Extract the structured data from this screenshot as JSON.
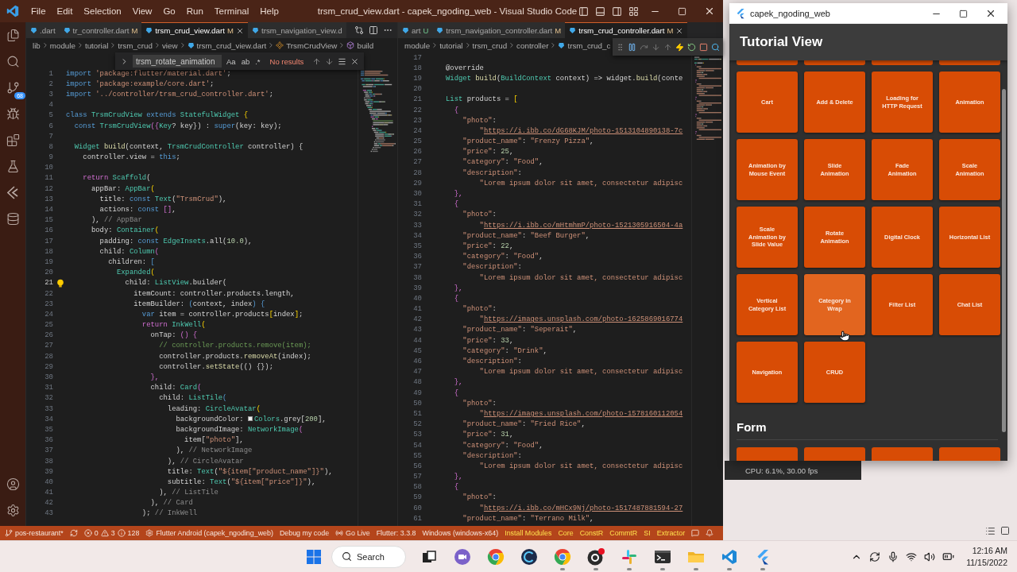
{
  "window": {
    "title": "trsm_crud_view.dart - capek_ngoding_web - Visual Studio Code",
    "menu": [
      "File",
      "Edit",
      "Selection",
      "View",
      "Go",
      "Run",
      "Terminal",
      "Help"
    ]
  },
  "activity_bar": {
    "items": [
      {
        "kind": "files"
      },
      {
        "kind": "search"
      },
      {
        "kind": "source_control",
        "badge": "68"
      },
      {
        "kind": "run"
      },
      {
        "kind": "extensions"
      },
      {
        "kind": "testing"
      },
      {
        "kind": "flutter"
      },
      {
        "kind": "database"
      }
    ],
    "bottom": [
      {
        "kind": "account"
      },
      {
        "kind": "settings"
      }
    ]
  },
  "editors": [
    {
      "tabs": [
        {
          "label": ".dart",
          "selected": false
        },
        {
          "label": "tr_controller.dart",
          "status": "M",
          "selected": false
        },
        {
          "label": "trsm_crud_view.dart",
          "status": "M",
          "selected": true
        },
        {
          "label": "trsm_navigation_view.d",
          "selected": false
        }
      ],
      "breadcrumbs": [
        {
          "label": "lib",
          "kind": "folder"
        },
        {
          "label": "module",
          "kind": "folder"
        },
        {
          "label": "tutorial",
          "kind": "folder"
        },
        {
          "label": "trsm_crud",
          "kind": "folder"
        },
        {
          "label": "view",
          "kind": "folder"
        },
        {
          "label": "trsm_crud_view.dart",
          "kind": "file"
        },
        {
          "label": "TrsmCrudView",
          "kind": "class"
        },
        {
          "label": "build",
          "kind": "method"
        }
      ],
      "find": {
        "value": "trsm_rotate_animation",
        "options": [
          "Aa",
          "ab",
          ".*"
        ],
        "result": "No results"
      },
      "lines": [
        {
          "n": "1",
          "active": false,
          "tokens": [
            {
              "text": "import ",
              "kind": "keyword"
            },
            {
              "text": "'package:flutter/material.dart'",
              "kind": "string"
            },
            {
              "text": ";",
              "kind": "plain"
            }
          ]
        },
        {
          "n": "2",
          "active": false,
          "tokens": [
            {
              "text": "import ",
              "kind": "keyword"
            },
            {
              "text": "'package:example/core.dart'",
              "kind": "string"
            },
            {
              "text": ";",
              "kind": "plain"
            }
          ]
        },
        {
          "n": "3",
          "active": false,
          "tokens": [
            {
              "text": "import ",
              "kind": "keyword"
            },
            {
              "text": "'../controller/trsm_crud_controller.dart'",
              "kind": "string"
            },
            {
              "text": ";",
              "kind": "plain"
            }
          ]
        },
        {
          "n": "4",
          "active": false
        },
        {
          "n": "5",
          "active": false,
          "tokens": [
            {
              "text": "class ",
              "kind": "keyword"
            },
            {
              "text": "TrsmCrudView ",
              "kind": "type"
            },
            {
              "text": "extends ",
              "kind": "keyword"
            },
            {
              "text": "StatefulWidget ",
              "kind": "type"
            },
            {
              "text": "{",
              "kind": "bracket"
            }
          ]
        },
        {
          "n": "6",
          "active": false,
          "tokens": [
            {
              "text": "  const ",
              "kind": "keyword"
            },
            {
              "text": "TrsmCrudView",
              "kind": "type"
            },
            {
              "text": "({",
              "kind": "control"
            },
            {
              "text": "Key",
              "kind": "type"
            },
            {
              "text": "? key}) : ",
              "kind": "plain"
            },
            {
              "text": "super",
              "kind": "keyword"
            },
            {
              "text": "(key: key);",
              "kind": "plain"
            }
          ]
        },
        {
          "n": "7",
          "active": false
        },
        {
          "n": "8",
          "active": false,
          "tokens": [
            {
              "text": "  Widget ",
              "kind": "type"
            },
            {
              "text": "build",
              "kind": "function"
            },
            {
              "text": "(context, ",
              "kind": "plain"
            },
            {
              "text": "TrsmCrudController ",
              "kind": "type"
            },
            {
              "text": "controller) {",
              "kind": "plain"
            }
          ]
        },
        {
          "n": "9",
          "active": false,
          "tokens": [
            {
              "text": "    controller.view = ",
              "kind": "plain"
            },
            {
              "text": "this",
              "kind": "keyword"
            },
            {
              "text": ";",
              "kind": "plain"
            }
          ]
        },
        {
          "n": "10",
          "active": false
        },
        {
          "n": "11",
          "active": false,
          "tokens": [
            {
              "text": "    return ",
              "kind": "control"
            },
            {
              "text": "Scaffold",
              "kind": "type"
            },
            {
              "text": "(",
              "kind": "plain"
            }
          ]
        },
        {
          "n": "12",
          "active": false,
          "tokens": [
            {
              "text": "      appBar: ",
              "kind": "plain"
            },
            {
              "text": "AppBar",
              "kind": "type"
            },
            {
              "text": "(",
              "kind": "bracket"
            }
          ]
        },
        {
          "n": "13",
          "active": false,
          "tokens": [
            {
              "text": "        title: ",
              "kind": "plain"
            },
            {
              "text": "const ",
              "kind": "keyword"
            },
            {
              "text": "Text",
              "kind": "type"
            },
            {
              "text": "(",
              "kind": "plain"
            },
            {
              "text": "\"TrsmCrud\"",
              "kind": "string"
            },
            {
              "text": "),",
              "kind": "plain"
            }
          ]
        },
        {
          "n": "14",
          "active": false,
          "tokens": [
            {
              "text": "        actions: ",
              "kind": "plain"
            },
            {
              "text": "const ",
              "kind": "keyword"
            },
            {
              "text": "[]",
              "kind": "control"
            },
            {
              "text": ",",
              "kind": "plain"
            }
          ]
        },
        {
          "n": "15",
          "active": false,
          "tokens": [
            {
              "text": "      ), ",
              "kind": "plain"
            },
            {
              "text": "// AppBar",
              "kind": "label"
            }
          ]
        },
        {
          "n": "16",
          "active": false,
          "tokens": [
            {
              "text": "      body: ",
              "kind": "plain"
            },
            {
              "text": "Container",
              "kind": "type"
            },
            {
              "text": "(",
              "kind": "bracket"
            }
          ]
        },
        {
          "n": "17",
          "active": false,
          "tokens": [
            {
              "text": "        padding: ",
              "kind": "plain"
            },
            {
              "text": "const ",
              "kind": "keyword"
            },
            {
              "text": "EdgeInsets",
              "kind": "type"
            },
            {
              "text": ".all(",
              "kind": "plain"
            },
            {
              "text": "10.0",
              "kind": "number"
            },
            {
              "text": "),",
              "kind": "plain"
            }
          ]
        },
        {
          "n": "18",
          "active": false,
          "tokens": [
            {
              "text": "        child: ",
              "kind": "plain"
            },
            {
              "text": "Column",
              "kind": "type"
            },
            {
              "text": "(",
              "kind": "control"
            }
          ]
        },
        {
          "n": "19",
          "active": false,
          "tokens": [
            {
              "text": "          children: ",
              "kind": "plain"
            },
            {
              "text": "[",
              "kind": "keyword"
            }
          ]
        },
        {
          "n": "20",
          "active": false,
          "tokens": [
            {
              "text": "            Expanded",
              "kind": "type"
            },
            {
              "text": "(",
              "kind": "bracket"
            }
          ]
        },
        {
          "n": "21",
          "active": true,
          "tokens": [
            {
              "text": "              child: ",
              "kind": "plain"
            },
            {
              "text": "ListView",
              "kind": "type"
            },
            {
              "text": ".builder(",
              "kind": "plain"
            }
          ]
        },
        {
          "n": "22",
          "active": false,
          "tokens": [
            {
              "text": "                itemCount: controller.products.length,",
              "kind": "plain"
            }
          ]
        },
        {
          "n": "23",
          "active": false,
          "tokens": [
            {
              "text": "                itemBuilder: ",
              "kind": "plain"
            },
            {
              "text": "(",
              "kind": "keyword"
            },
            {
              "text": "context, index",
              "kind": "plain"
            },
            {
              "text": ") {",
              "kind": "keyword"
            }
          ]
        },
        {
          "n": "24",
          "active": false,
          "tokens": [
            {
              "text": "                  var ",
              "kind": "keyword"
            },
            {
              "text": "item = controller.products",
              "kind": "plain"
            },
            {
              "text": "[",
              "kind": "bracket"
            },
            {
              "text": "index",
              "kind": "plain"
            },
            {
              "text": "]",
              "kind": "bracket"
            },
            {
              "text": ";",
              "kind": "plain"
            }
          ]
        },
        {
          "n": "25",
          "active": false,
          "tokens": [
            {
              "text": "                  return ",
              "kind": "control"
            },
            {
              "text": "InkWell",
              "kind": "type"
            },
            {
              "text": "(",
              "kind": "bracket"
            }
          ]
        },
        {
          "n": "26",
          "active": false,
          "tokens": [
            {
              "text": "                    onTap: ",
              "kind": "plain"
            },
            {
              "text": "() {",
              "kind": "control"
            }
          ]
        },
        {
          "n": "27",
          "active": false,
          "tokens": [
            {
              "text": "                      // controller.products.remove(item);",
              "kind": "comment"
            }
          ]
        },
        {
          "n": "28",
          "active": false,
          "tokens": [
            {
              "text": "                      controller.products.",
              "kind": "plain"
            },
            {
              "text": "removeAt",
              "kind": "function"
            },
            {
              "text": "(index);",
              "kind": "plain"
            }
          ]
        },
        {
          "n": "29",
          "active": false,
          "tokens": [
            {
              "text": "                      controller.",
              "kind": "plain"
            },
            {
              "text": "setState",
              "kind": "function"
            },
            {
              "text": "(() {});",
              "kind": "plain"
            }
          ]
        },
        {
          "n": "30",
          "active": false,
          "tokens": [
            {
              "text": "                    },",
              "kind": "control"
            }
          ]
        },
        {
          "n": "31",
          "active": false,
          "tokens": [
            {
              "text": "                    child: ",
              "kind": "plain"
            },
            {
              "text": "Card",
              "kind": "type"
            },
            {
              "text": "(",
              "kind": "control"
            }
          ]
        },
        {
          "n": "32",
          "active": false,
          "tokens": [
            {
              "text": "                      child: ",
              "kind": "plain"
            },
            {
              "text": "ListTile",
              "kind": "type"
            },
            {
              "text": "(",
              "kind": "keyword"
            }
          ]
        },
        {
          "n": "33",
          "active": false,
          "tokens": [
            {
              "text": "                        leading: ",
              "kind": "plain"
            },
            {
              "text": "CircleAvatar",
              "kind": "type"
            },
            {
              "text": "(",
              "kind": "bracket"
            }
          ]
        },
        {
          "n": "34",
          "active": false,
          "tokens": [
            {
              "text": "                          backgroundColor: ",
              "kind": "plain"
            },
            {
              "text": "Colors",
              "kind": "swatch"
            },
            {
              "text": ".grey[",
              "kind": "plain"
            },
            {
              "text": "200",
              "kind": "number"
            },
            {
              "text": "],",
              "kind": "plain"
            }
          ]
        },
        {
          "n": "35",
          "active": false,
          "tokens": [
            {
              "text": "                          backgroundImage: ",
              "kind": "plain"
            },
            {
              "text": "NetworkImage",
              "kind": "type"
            },
            {
              "text": "(",
              "kind": "control"
            }
          ]
        },
        {
          "n": "36",
          "active": false,
          "tokens": [
            {
              "text": "                            item[",
              "kind": "plain"
            },
            {
              "text": "\"photo\"",
              "kind": "string"
            },
            {
              "text": "],",
              "kind": "plain"
            }
          ]
        },
        {
          "n": "37",
          "active": false,
          "tokens": [
            {
              "text": "                          ), ",
              "kind": "plain"
            },
            {
              "text": "// NetworkImage",
              "kind": "label"
            }
          ]
        },
        {
          "n": "38",
          "active": false,
          "tokens": [
            {
              "text": "                        ), ",
              "kind": "plain"
            },
            {
              "text": "// CircleAvatar",
              "kind": "label"
            }
          ]
        },
        {
          "n": "39",
          "active": false,
          "tokens": [
            {
              "text": "                        title: ",
              "kind": "plain"
            },
            {
              "text": "Text",
              "kind": "type"
            },
            {
              "text": "(",
              "kind": "plain"
            },
            {
              "text": "\"${item[\"product_name\"]}\"",
              "kind": "string"
            },
            {
              "text": "),",
              "kind": "plain"
            }
          ]
        },
        {
          "n": "40",
          "active": false,
          "tokens": [
            {
              "text": "                        subtitle: ",
              "kind": "plain"
            },
            {
              "text": "Text",
              "kind": "type"
            },
            {
              "text": "(",
              "kind": "plain"
            },
            {
              "text": "\"${item[\"price\"]}\"",
              "kind": "string"
            },
            {
              "text": "),",
              "kind": "plain"
            }
          ]
        },
        {
          "n": "41",
          "active": false,
          "tokens": [
            {
              "text": "                      ), ",
              "kind": "plain"
            },
            {
              "text": "// ListTile",
              "kind": "label"
            }
          ]
        },
        {
          "n": "42",
          "active": false,
          "tokens": [
            {
              "text": "                    ), ",
              "kind": "plain"
            },
            {
              "text": "// Card",
              "kind": "label"
            }
          ]
        },
        {
          "n": "43",
          "active": false,
          "tokens": [
            {
              "text": "                  ); ",
              "kind": "plain"
            },
            {
              "text": "// InkWell",
              "kind": "label"
            }
          ]
        }
      ]
    },
    {
      "tabs": [
        {
          "label": "art",
          "status": "U",
          "selected": false
        },
        {
          "label": "trsm_navigation_controller.dart",
          "status": "M",
          "selected": false
        },
        {
          "label": "trsm_crud_controller.dart",
          "status": "M",
          "selected": true
        }
      ],
      "breadcrumbs": [
        {
          "label": "module",
          "kind": "folder"
        },
        {
          "label": "tutorial",
          "kind": "folder"
        },
        {
          "label": "trsm_crud",
          "kind": "folder"
        },
        {
          "label": "controller",
          "kind": "folder"
        },
        {
          "label": "trsm_crud_c",
          "kind": "file"
        }
      ],
      "debug_toolbar": true,
      "lines": [
        {
          "n": "17",
          "active": false
        },
        {
          "n": "18",
          "active": false,
          "tokens": [
            {
              "text": "@override",
              "kind": "plain"
            }
          ]
        },
        {
          "n": "19",
          "active": false,
          "tokens": [
            {
              "text": "Widget ",
              "kind": "type"
            },
            {
              "text": "build",
              "kind": "function"
            },
            {
              "text": "(",
              "kind": "plain"
            },
            {
              "text": "BuildContext ",
              "kind": "type"
            },
            {
              "text": "context) => widget.",
              "kind": "plain"
            },
            {
              "text": "build",
              "kind": "function"
            },
            {
              "text": "(conte",
              "kind": "plain"
            }
          ]
        },
        {
          "n": "20",
          "active": false
        },
        {
          "n": "21",
          "active": false,
          "tokens": [
            {
              "text": "List ",
              "kind": "type"
            },
            {
              "text": "products = ",
              "kind": "plain"
            },
            {
              "text": "[",
              "kind": "bracket"
            }
          ]
        },
        {
          "n": "22",
          "active": false,
          "tokens": [
            {
              "text": "  {",
              "kind": "control"
            }
          ]
        },
        {
          "n": "23",
          "active": false,
          "tokens": [
            {
              "text": "    \"photo\"",
              "kind": "string"
            },
            {
              "text": ":",
              "kind": "plain"
            }
          ]
        },
        {
          "n": "24",
          "active": false,
          "tokens": [
            {
              "text": "        \"https://i.ibb.co/dG68KJM/photo-1513104890138-7c",
              "kind": "link"
            }
          ]
        },
        {
          "n": "25",
          "active": false,
          "tokens": [
            {
              "text": "    \"product_name\"",
              "kind": "string"
            },
            {
              "text": ": ",
              "kind": "plain"
            },
            {
              "text": "\"Frenzy Pizza\"",
              "kind": "string"
            },
            {
              "text": ",",
              "kind": "plain"
            }
          ]
        },
        {
          "n": "26",
          "active": false,
          "tokens": [
            {
              "text": "    \"price\"",
              "kind": "string"
            },
            {
              "text": ": ",
              "kind": "plain"
            },
            {
              "text": "25",
              "kind": "number"
            },
            {
              "text": ",",
              "kind": "plain"
            }
          ]
        },
        {
          "n": "27",
          "active": false,
          "tokens": [
            {
              "text": "    \"category\"",
              "kind": "string"
            },
            {
              "text": ": ",
              "kind": "plain"
            },
            {
              "text": "\"Food\"",
              "kind": "string"
            },
            {
              "text": ",",
              "kind": "plain"
            }
          ]
        },
        {
          "n": "28",
          "active": false,
          "tokens": [
            {
              "text": "    \"description\"",
              "kind": "string"
            },
            {
              "text": ":",
              "kind": "plain"
            }
          ]
        },
        {
          "n": "29",
          "active": false,
          "tokens": [
            {
              "text": "        \"Lorem ipsum dolor sit amet, consectetur adipisc",
              "kind": "string"
            }
          ]
        },
        {
          "n": "30",
          "active": false,
          "tokens": [
            {
              "text": "  },",
              "kind": "control"
            }
          ]
        },
        {
          "n": "31",
          "active": false,
          "tokens": [
            {
              "text": "  {",
              "kind": "control"
            }
          ]
        },
        {
          "n": "32",
          "active": false,
          "tokens": [
            {
              "text": "    \"photo\"",
              "kind": "string"
            },
            {
              "text": ":",
              "kind": "plain"
            }
          ]
        },
        {
          "n": "33",
          "active": false,
          "tokens": [
            {
              "text": "        \"https://i.ibb.co/mHtmhmP/photo-1521305916504-4a",
              "kind": "link"
            }
          ]
        },
        {
          "n": "34",
          "active": false,
          "tokens": [
            {
              "text": "    \"product_name\"",
              "kind": "string"
            },
            {
              "text": ": ",
              "kind": "plain"
            },
            {
              "text": "\"Beef Burger\"",
              "kind": "string"
            },
            {
              "text": ",",
              "kind": "plain"
            }
          ]
        },
        {
          "n": "35",
          "active": false,
          "tokens": [
            {
              "text": "    \"price\"",
              "kind": "string"
            },
            {
              "text": ": ",
              "kind": "plain"
            },
            {
              "text": "22",
              "kind": "number"
            },
            {
              "text": ",",
              "kind": "plain"
            }
          ]
        },
        {
          "n": "36",
          "active": false,
          "tokens": [
            {
              "text": "    \"category\"",
              "kind": "string"
            },
            {
              "text": ": ",
              "kind": "plain"
            },
            {
              "text": "\"Food\"",
              "kind": "string"
            },
            {
              "text": ",",
              "kind": "plain"
            }
          ]
        },
        {
          "n": "37",
          "active": false,
          "tokens": [
            {
              "text": "    \"description\"",
              "kind": "string"
            },
            {
              "text": ":",
              "kind": "plain"
            }
          ]
        },
        {
          "n": "38",
          "active": false,
          "tokens": [
            {
              "text": "        \"Lorem ipsum dolor sit amet, consectetur adipisc",
              "kind": "string"
            }
          ]
        },
        {
          "n": "39",
          "active": false,
          "tokens": [
            {
              "text": "  },",
              "kind": "control"
            }
          ]
        },
        {
          "n": "40",
          "active": false,
          "tokens": [
            {
              "text": "  {",
              "kind": "control"
            }
          ]
        },
        {
          "n": "41",
          "active": false,
          "tokens": [
            {
              "text": "    \"photo\"",
              "kind": "string"
            },
            {
              "text": ":",
              "kind": "plain"
            }
          ]
        },
        {
          "n": "42",
          "active": false,
          "tokens": [
            {
              "text": "        \"https://images.unsplash.com/photo-1625869016774",
              "kind": "link"
            }
          ]
        },
        {
          "n": "43",
          "active": false,
          "tokens": [
            {
              "text": "    \"product_name\"",
              "kind": "string"
            },
            {
              "text": ": ",
              "kind": "plain"
            },
            {
              "text": "\"Seperait\"",
              "kind": "string"
            },
            {
              "text": ",",
              "kind": "plain"
            }
          ]
        },
        {
          "n": "44",
          "active": false,
          "tokens": [
            {
              "text": "    \"price\"",
              "kind": "string"
            },
            {
              "text": ": ",
              "kind": "plain"
            },
            {
              "text": "33",
              "kind": "number"
            },
            {
              "text": ",",
              "kind": "plain"
            }
          ]
        },
        {
          "n": "45",
          "active": false,
          "tokens": [
            {
              "text": "    \"category\"",
              "kind": "string"
            },
            {
              "text": ": ",
              "kind": "plain"
            },
            {
              "text": "\"Drink\"",
              "kind": "string"
            },
            {
              "text": ",",
              "kind": "plain"
            }
          ]
        },
        {
          "n": "46",
          "active": false,
          "tokens": [
            {
              "text": "    \"description\"",
              "kind": "string"
            },
            {
              "text": ":",
              "kind": "plain"
            }
          ]
        },
        {
          "n": "47",
          "active": false,
          "tokens": [
            {
              "text": "        \"Lorem ipsum dolor sit amet, consectetur adipisc",
              "kind": "string"
            }
          ]
        },
        {
          "n": "48",
          "active": false,
          "tokens": [
            {
              "text": "  },",
              "kind": "control"
            }
          ]
        },
        {
          "n": "49",
          "active": false,
          "tokens": [
            {
              "text": "  {",
              "kind": "control"
            }
          ]
        },
        {
          "n": "50",
          "active": false,
          "tokens": [
            {
              "text": "    \"photo\"",
              "kind": "string"
            },
            {
              "text": ":",
              "kind": "plain"
            }
          ]
        },
        {
          "n": "51",
          "active": false,
          "tokens": [
            {
              "text": "        \"https://images.unsplash.com/photo-1578160112054",
              "kind": "link"
            }
          ]
        },
        {
          "n": "52",
          "active": false,
          "tokens": [
            {
              "text": "    \"product_name\"",
              "kind": "string"
            },
            {
              "text": ": ",
              "kind": "plain"
            },
            {
              "text": "\"Fried Rice\"",
              "kind": "string"
            },
            {
              "text": ",",
              "kind": "plain"
            }
          ]
        },
        {
          "n": "53",
          "active": false,
          "tokens": [
            {
              "text": "    \"price\"",
              "kind": "string"
            },
            {
              "text": ": ",
              "kind": "plain"
            },
            {
              "text": "31",
              "kind": "number"
            },
            {
              "text": ",",
              "kind": "plain"
            }
          ]
        },
        {
          "n": "54",
          "active": false,
          "tokens": [
            {
              "text": "    \"category\"",
              "kind": "string"
            },
            {
              "text": ": ",
              "kind": "plain"
            },
            {
              "text": "\"Food\"",
              "kind": "string"
            },
            {
              "text": ",",
              "kind": "plain"
            }
          ]
        },
        {
          "n": "55",
          "active": false,
          "tokens": [
            {
              "text": "    \"description\"",
              "kind": "string"
            },
            {
              "text": ":",
              "kind": "plain"
            }
          ]
        },
        {
          "n": "56",
          "active": false,
          "tokens": [
            {
              "text": "        \"Lorem ipsum dolor sit amet, consectetur adipisc",
              "kind": "string"
            }
          ]
        },
        {
          "n": "57",
          "active": false,
          "tokens": [
            {
              "text": "  },",
              "kind": "control"
            }
          ]
        },
        {
          "n": "58",
          "active": false,
          "tokens": [
            {
              "text": "  {",
              "kind": "control"
            }
          ]
        },
        {
          "n": "59",
          "active": false,
          "tokens": [
            {
              "text": "    \"photo\"",
              "kind": "string"
            },
            {
              "text": ":",
              "kind": "plain"
            }
          ]
        },
        {
          "n": "60",
          "active": false,
          "tokens": [
            {
              "text": "        \"https://i.ibb.co/mHCx9Nj/photo-1517487881594-27",
              "kind": "link"
            }
          ]
        },
        {
          "n": "61",
          "active": false,
          "tokens": [
            {
              "text": "    \"product_name\"",
              "kind": "string"
            },
            {
              "text": ": ",
              "kind": "plain"
            },
            {
              "text": "\"Terrano Milk\"",
              "kind": "string"
            },
            {
              "text": ",",
              "kind": "plain"
            }
          ]
        }
      ]
    }
  ],
  "status_bar": [
    {
      "kind": "branch",
      "text": "pos-restaurant*"
    },
    {
      "kind": "sync"
    },
    {
      "kind": "problems",
      "errors": "0",
      "warnings": "3",
      "infos": "128"
    },
    {
      "kind": "device",
      "text": "Flutter Android (capek_ngoding_web)"
    },
    {
      "kind": "plain",
      "text": "Debug my code"
    },
    {
      "kind": "live",
      "text": "Go Live"
    },
    {
      "kind": "plain",
      "text": "Flutter: 3.3.8"
    },
    {
      "kind": "plain",
      "text": "Windows (windows-x64)"
    },
    {
      "kind": "accent",
      "text": "Install Modules"
    },
    {
      "kind": "accent",
      "text": "Core"
    },
    {
      "kind": "accent",
      "text": "ConstR"
    },
    {
      "kind": "accent",
      "text": "CommtR"
    },
    {
      "kind": "accent",
      "text": "SI"
    },
    {
      "kind": "accent",
      "text": "Extractor"
    },
    {
      "kind": "feedback"
    },
    {
      "kind": "bell"
    }
  ],
  "flutter_app": {
    "title": "capek_ngoding_web",
    "app_bar_title": "Tutorial View",
    "tiles": [
      {
        "label": "Cart",
        "hovered": false
      },
      {
        "label": "Add & Delete",
        "hovered": false
      },
      {
        "label": "Loading for\nHTTP Request",
        "hovered": false
      },
      {
        "label": "Animation",
        "hovered": false
      },
      {
        "label": "Animation by\nMouse Event",
        "hovered": false
      },
      {
        "label": "Slide\nAnimation",
        "hovered": false
      },
      {
        "label": "Fade\nAnimation",
        "hovered": false
      },
      {
        "label": "Scale\nAnimation",
        "hovered": false
      },
      {
        "label": "Scale\nAnimation by\nSlide Value",
        "hovered": false
      },
      {
        "label": "Rotate\nAnimation",
        "hovered": false
      },
      {
        "label": "Digital Clock",
        "hovered": false
      },
      {
        "label": "Horizontal List",
        "hovered": false
      },
      {
        "label": "Vertical\nCategory List",
        "hovered": false
      },
      {
        "label": "Category in\nWrap",
        "hovered": true
      },
      {
        "label": "Filter List",
        "hovered": false
      },
      {
        "label": "Chat List",
        "hovered": false
      },
      {
        "label": "Navigation",
        "hovered": false
      },
      {
        "label": "CRUD",
        "hovered": false
      }
    ],
    "next_section": "Form"
  },
  "perf_overlay": "CPU: 6.1%, 30.00 fps",
  "taskbar": {
    "search": "Search",
    "apps": [
      {
        "kind": "taskview",
        "running": false
      },
      {
        "kind": "chat",
        "running": false
      },
      {
        "kind": "browser",
        "running": false
      },
      {
        "kind": "cleaner",
        "running": false
      },
      {
        "kind": "browser",
        "running": true
      },
      {
        "kind": "recorder",
        "running": true
      },
      {
        "kind": "slack",
        "running": true
      },
      {
        "kind": "terminal",
        "running": true
      },
      {
        "kind": "folder",
        "running": true
      },
      {
        "kind": "vscode",
        "running": true
      },
      {
        "kind": "flutter",
        "running": true
      }
    ],
    "time": "12:16 AM",
    "date": "11/15/2022"
  }
}
